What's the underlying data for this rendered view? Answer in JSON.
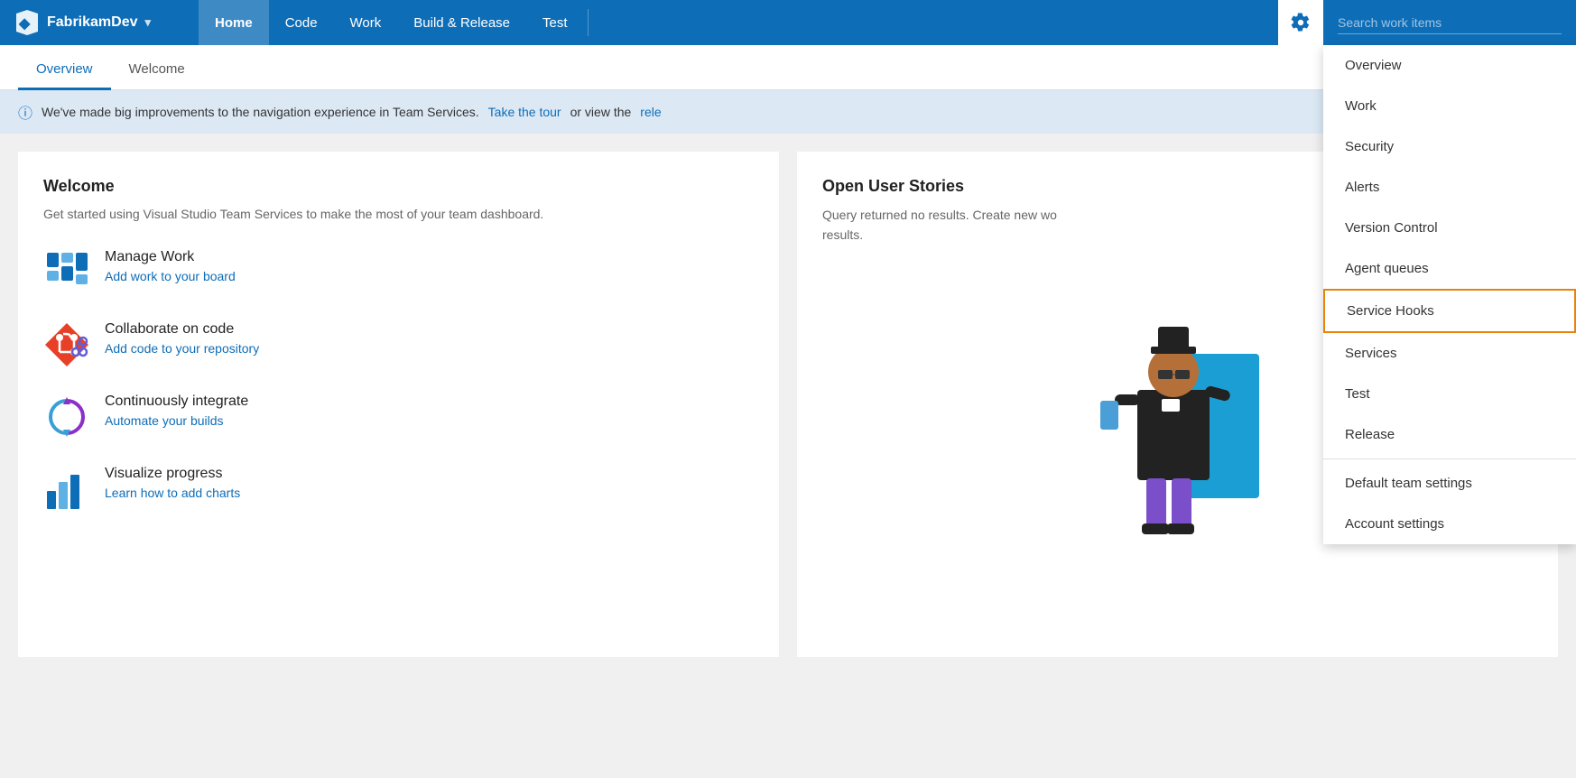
{
  "brand": {
    "name": "FabrikamDev",
    "dropdown_arrow": "▾"
  },
  "nav": {
    "links": [
      {
        "id": "home",
        "label": "Home",
        "active": true
      },
      {
        "id": "code",
        "label": "Code",
        "active": false
      },
      {
        "id": "work",
        "label": "Work",
        "active": false
      },
      {
        "id": "build-release",
        "label": "Build & Release",
        "active": false
      },
      {
        "id": "test",
        "label": "Test",
        "active": false
      }
    ],
    "search_placeholder": "Search work items"
  },
  "tabs": [
    {
      "id": "overview",
      "label": "Overview",
      "active": true
    },
    {
      "id": "welcome",
      "label": "Welcome",
      "active": false
    }
  ],
  "notification": {
    "text": "We've made big improvements to the navigation experience in Team Services.",
    "link1_text": "Take the tour",
    "link2_text": "rele",
    "suffix": " or view the "
  },
  "welcome_card": {
    "title": "Welcome",
    "subtitle": "Get started using Visual Studio Team Services to make the most of your team dashboard.",
    "items": [
      {
        "id": "manage-work",
        "title": "Manage Work",
        "link": "Add work to your board"
      },
      {
        "id": "collaborate-code",
        "title": "Collaborate on code",
        "link": "Add code to your repository"
      },
      {
        "id": "continuously-integrate",
        "title": "Continuously integrate",
        "link": "Automate your builds"
      },
      {
        "id": "visualize-progress",
        "title": "Visualize progress",
        "link": "Learn how to add charts"
      }
    ]
  },
  "user_stories_card": {
    "title": "Open User Stories",
    "empty_text": "Query returned no results. Create new wo",
    "empty_text2": "results."
  },
  "dropdown_menu": {
    "items": [
      {
        "id": "overview",
        "label": "Overview",
        "highlighted": false
      },
      {
        "id": "work",
        "label": "Work",
        "highlighted": false
      },
      {
        "id": "security",
        "label": "Security",
        "highlighted": false
      },
      {
        "id": "alerts",
        "label": "Alerts",
        "highlighted": false
      },
      {
        "id": "version-control",
        "label": "Version Control",
        "highlighted": false
      },
      {
        "id": "agent-queues",
        "label": "Agent queues",
        "highlighted": false
      },
      {
        "id": "service-hooks",
        "label": "Service Hooks",
        "highlighted": true
      },
      {
        "id": "services",
        "label": "Services",
        "highlighted": false
      },
      {
        "id": "test",
        "label": "Test",
        "highlighted": false
      },
      {
        "id": "release",
        "label": "Release",
        "highlighted": false
      }
    ],
    "divider_after": "release",
    "bottom_items": [
      {
        "id": "default-team-settings",
        "label": "Default team settings"
      },
      {
        "id": "account-settings",
        "label": "Account settings"
      }
    ]
  }
}
